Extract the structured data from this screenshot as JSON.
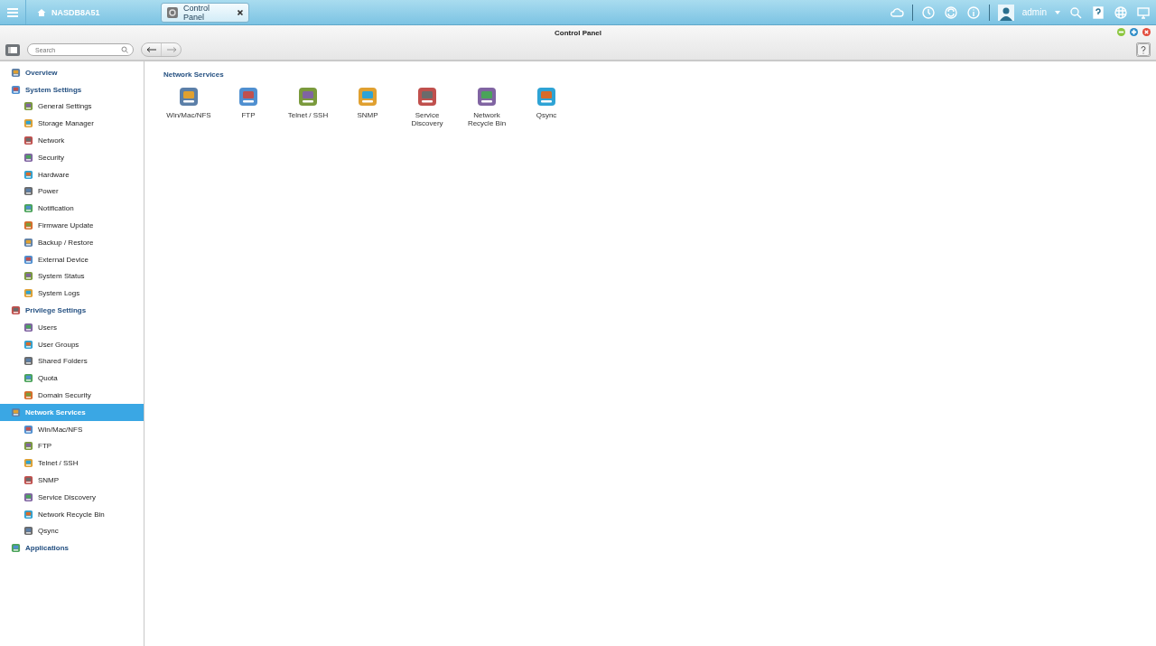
{
  "taskbar": {
    "host": "NASDB8A51",
    "tabs": [
      {
        "label": "Control Panel",
        "selected": true
      }
    ],
    "user": "admin"
  },
  "window": {
    "title": "Control Panel",
    "search": {
      "placeholder": "Search"
    }
  },
  "sidebar": {
    "items": [
      {
        "label": "Overview",
        "selected": false
      },
      {
        "label": "System Settings",
        "selected": false,
        "children": [
          {
            "label": "General Settings",
            "selected": false
          },
          {
            "label": "Storage Manager",
            "selected": false
          },
          {
            "label": "Network",
            "selected": false
          },
          {
            "label": "Security",
            "selected": false
          },
          {
            "label": "Hardware",
            "selected": false
          },
          {
            "label": "Power",
            "selected": false
          },
          {
            "label": "Notification",
            "selected": false
          },
          {
            "label": "Firmware Update",
            "selected": false
          },
          {
            "label": "Backup / Restore",
            "selected": false
          },
          {
            "label": "External Device",
            "selected": false
          },
          {
            "label": "System Status",
            "selected": false
          },
          {
            "label": "System Logs",
            "selected": false
          }
        ]
      },
      {
        "label": "Privilege Settings",
        "selected": false,
        "children": [
          {
            "label": "Users",
            "selected": false
          },
          {
            "label": "User Groups",
            "selected": false
          },
          {
            "label": "Shared Folders",
            "selected": false
          },
          {
            "label": "Quota",
            "selected": false
          },
          {
            "label": "Domain Security",
            "selected": false
          }
        ]
      },
      {
        "label": "Network Services",
        "selected": true,
        "children": [
          {
            "label": "Win/Mac/NFS",
            "selected": false
          },
          {
            "label": "FTP",
            "selected": false
          },
          {
            "label": "Telnet / SSH",
            "selected": false
          },
          {
            "label": "SNMP",
            "selected": false
          },
          {
            "label": "Service Discovery",
            "selected": false
          },
          {
            "label": "Network Recycle Bin",
            "selected": false
          },
          {
            "label": "Qsync",
            "selected": false
          }
        ]
      },
      {
        "label": "Applications",
        "selected": false
      }
    ]
  },
  "content": {
    "title": "Network Services",
    "items": [
      {
        "label": "Win/Mac/NFS"
      },
      {
        "label": "FTP"
      },
      {
        "label": "Telnet / SSH"
      },
      {
        "label": "SNMP"
      },
      {
        "label": "Service Discovery"
      },
      {
        "label": "Network Recycle Bin"
      },
      {
        "label": "Qsync"
      }
    ]
  }
}
